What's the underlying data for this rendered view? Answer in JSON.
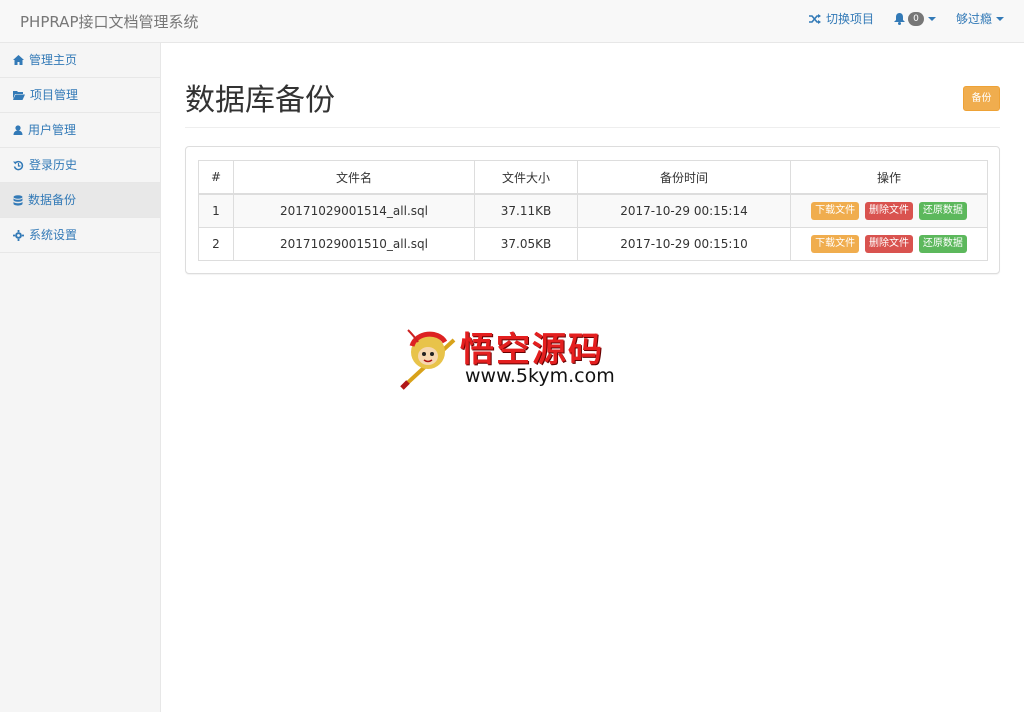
{
  "navbar": {
    "brand": "PHPRAP接口文档管理系统",
    "switch_project": "切换项目",
    "notification_count": "0",
    "username": "够过瘾",
    "icons": [
      "shuffle-icon",
      "bell-icon"
    ]
  },
  "sidebar": {
    "items": [
      {
        "label": "管理主页",
        "icon": "home-icon"
      },
      {
        "label": "项目管理",
        "icon": "folder-open-icon"
      },
      {
        "label": "用户管理",
        "icon": "user-icon"
      },
      {
        "label": "登录历史",
        "icon": "history-icon"
      },
      {
        "label": "数据备份",
        "icon": "database-icon",
        "active": true
      },
      {
        "label": "系统设置",
        "icon": "gear-icon"
      }
    ]
  },
  "main": {
    "title": "数据库备份",
    "backup_button": "备份",
    "table": {
      "headers": [
        "#",
        "文件名",
        "文件大小",
        "备份时间",
        "操作"
      ],
      "rows": [
        {
          "index": "1",
          "filename": "20171029001514_all.sql",
          "size": "37.11KB",
          "time": "2017-10-29 00:15:14"
        },
        {
          "index": "2",
          "filename": "20171029001510_all.sql",
          "size": "37.05KB",
          "time": "2017-10-29 00:15:10"
        }
      ],
      "actions": {
        "download": "下载文件",
        "delete": "删除文件",
        "restore": "还原数据"
      }
    }
  },
  "watermark": {
    "title": "悟空源码",
    "url": "www.5kym.com"
  },
  "colors": {
    "link": "#337ab7",
    "warning": "#f0ad4e",
    "danger": "#d9534f",
    "success": "#5cb85c"
  }
}
